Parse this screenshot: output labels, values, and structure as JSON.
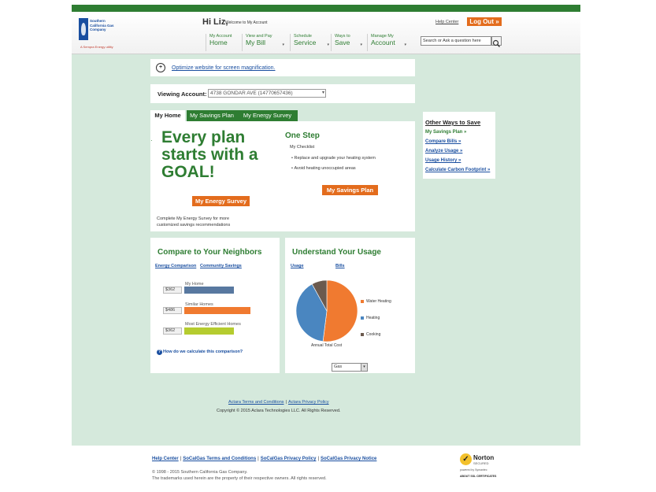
{
  "header": {
    "logo_text": "Southern California Gas Company",
    "logo_subtext": "A Sempra Energy utility",
    "greeting": "Hi Liz,",
    "welcome": "Welcome to My Account",
    "help_center": "Help Center",
    "logout": "Log Out »",
    "nav": [
      {
        "small": "My Account",
        "big": "Home"
      },
      {
        "small": "View and Pay",
        "big": "My Bill"
      },
      {
        "small": "Schedule",
        "big": "Service"
      },
      {
        "small": "Ways to",
        "big": "Save"
      },
      {
        "small": "Manage My",
        "big": "Account"
      }
    ],
    "search_placeholder": "Search or Ask a question here"
  },
  "magnify_text": "Optimize website for screen magnification.",
  "account": {
    "label": "Viewing Account:",
    "value": "4738 GONDAR AVE (14770657436)"
  },
  "tabs": [
    "My Home",
    "My Savings Plan",
    "My Energy Survey"
  ],
  "home": {
    "goal_text": "Every plan starts with a GOAL!",
    "survey_button": "My Energy Survey",
    "survey_note": "Complete My Energy Survey for more customized savings recommendations",
    "one_step": "One Step",
    "checklist_label": "My Checklist",
    "checklist": [
      "Replace and upgrade your heating system",
      "Avoid heating unoccupied areas"
    ],
    "savings_button": "My Savings Plan"
  },
  "sidebar": {
    "title": "Other Ways to Save",
    "links": [
      "My Savings Plan »",
      "Compare Bills »",
      "Analyze Usage »",
      "Usage History »",
      "Calculate Carbon Footprint »"
    ]
  },
  "compare": {
    "title": "Compare to Your Neighbors",
    "links": [
      "Energy Comparison",
      "Community Savings"
    ],
    "rows": [
      {
        "label": "My Home",
        "value": "$362",
        "amount": 362,
        "color": "#5878a0"
      },
      {
        "label": "Similar Homes",
        "value": "$486",
        "amount": 486,
        "color": "#f07a30"
      },
      {
        "label": "Most Energy Efficient Homes",
        "value": "$362",
        "amount": 362,
        "color": "#b5cc2f"
      }
    ],
    "info_link": "How do we calculate this comparison?"
  },
  "usage": {
    "title": "Understand Your Usage",
    "links": [
      "Usage",
      "Bills"
    ],
    "pie_caption": "Annual Total Cost",
    "fuel_select": "Gas"
  },
  "chart_data": {
    "type": "pie",
    "title": "",
    "caption": "Annual Total Cost",
    "categories": [
      "Water Heating",
      "Heating",
      "Cooking"
    ],
    "values": [
      52,
      40,
      8
    ],
    "colors": [
      "#f07a30",
      "#4a86c0",
      "#6b5a4e"
    ]
  },
  "footer_inner": {
    "links": [
      "Actara Terms and Conditions",
      "Actara Privacy Policy"
    ],
    "copyright": "Copyright © 2015 Aclara Technologies LLC. All Rights Reserved."
  },
  "footer": {
    "links": [
      "Help Center",
      "SoCalGas Terms and Conditions",
      "SoCalGas Privacy Policy",
      "SoCalGas Privacy Notice"
    ],
    "copyright1": "© 1998 - 2015 Southern California Gas Company.",
    "copyright2": "The trademarks used herein are the property of their respective owners. All rights reserved.",
    "norton": {
      "name": "Norton",
      "secured": "SECURED",
      "by": "powered by Symantec",
      "about": "ABOUT SSL CERTIFICATES"
    }
  }
}
